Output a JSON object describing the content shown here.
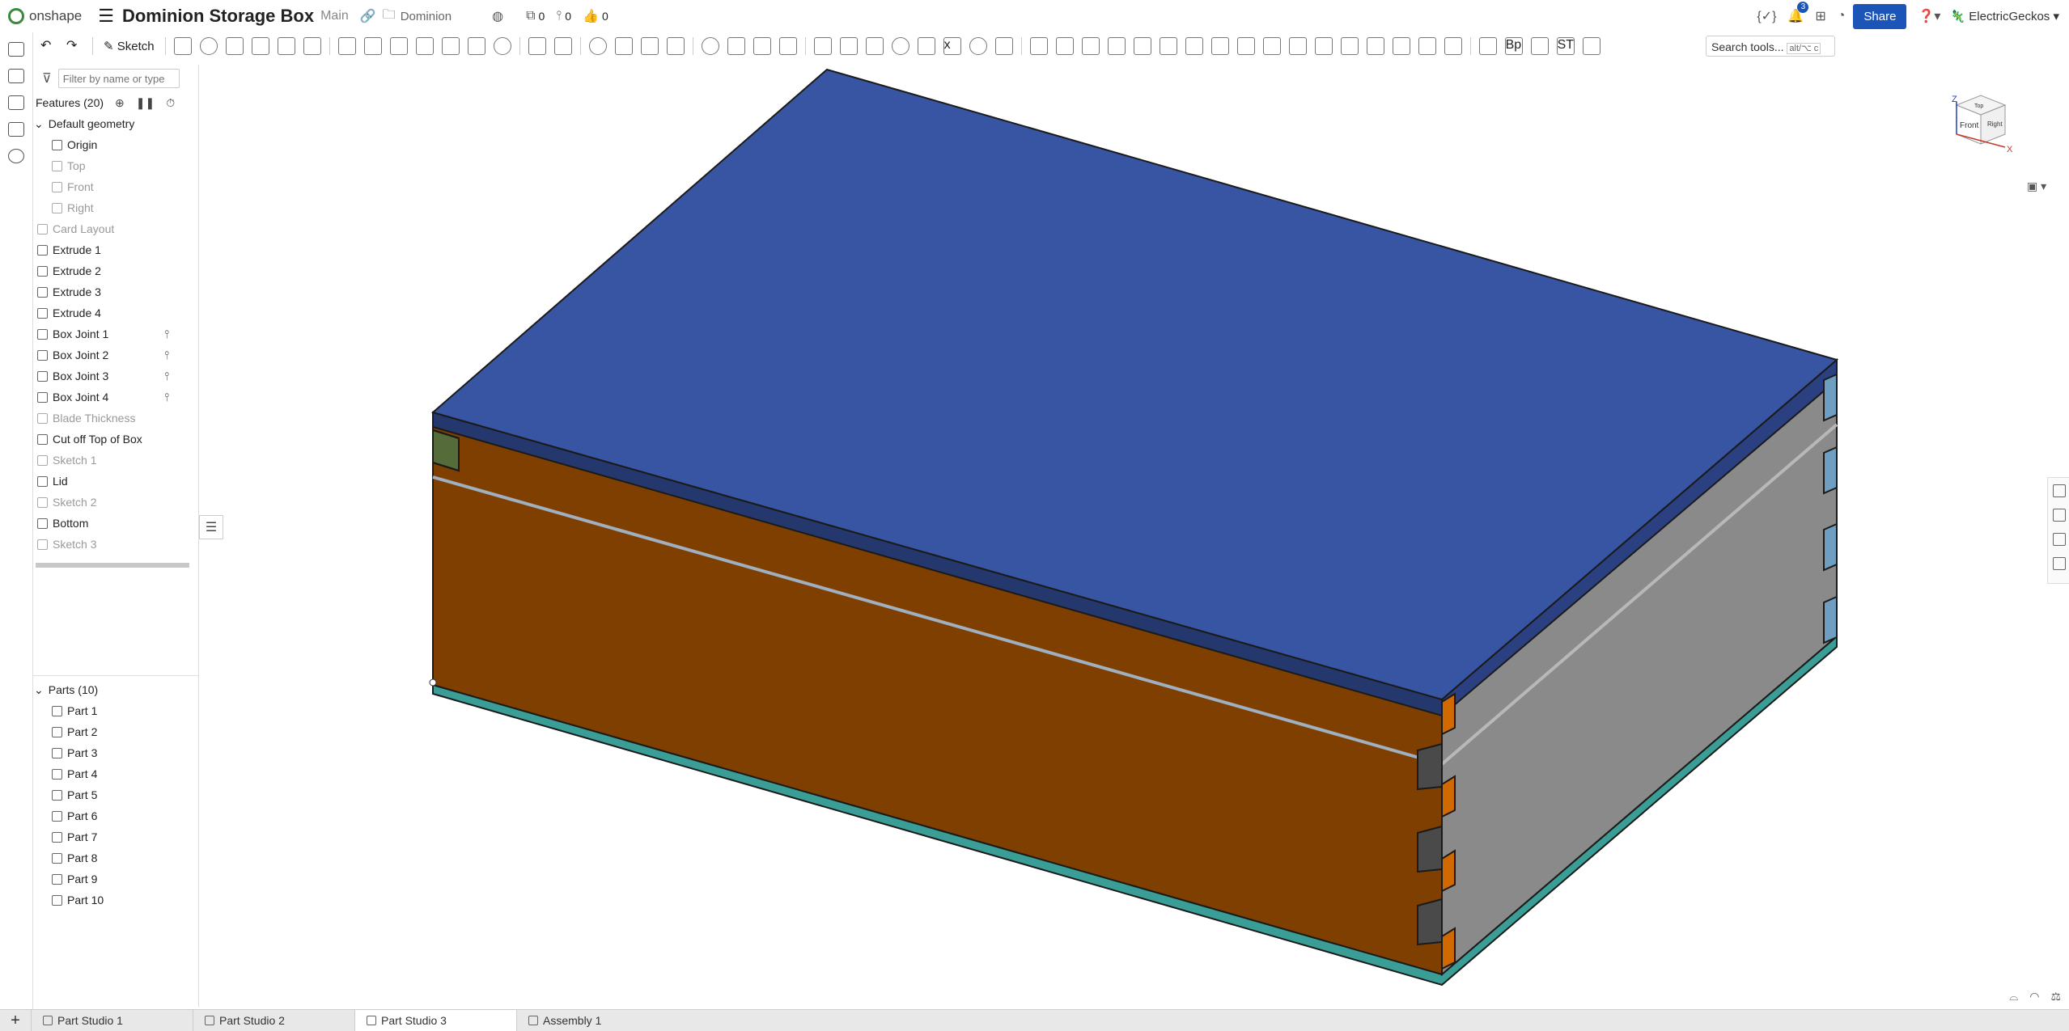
{
  "header": {
    "logo_text": "onshape",
    "doc_title": "Dominion Storage Box",
    "branch": "Main",
    "folder": "Dominion",
    "versions_count": "0",
    "branches_count": "0",
    "likes_count": "0",
    "notifications_count": "3",
    "share_label": "Share",
    "user_name": "ElectricGeckos"
  },
  "toolbar": {
    "sketch_label": "Sketch",
    "search_placeholder": "Search tools...",
    "search_shortcut": "alt/⌥ c"
  },
  "features": {
    "filter_placeholder": "Filter by name or type",
    "header": "Features (20)",
    "default_geometry": "Default geometry",
    "items": [
      {
        "label": "Origin",
        "indent": 2,
        "dim": false
      },
      {
        "label": "Top",
        "indent": 2,
        "dim": true
      },
      {
        "label": "Front",
        "indent": 2,
        "dim": true
      },
      {
        "label": "Right",
        "indent": 2,
        "dim": true
      },
      {
        "label": "Card Layout",
        "indent": 1,
        "dim": true
      },
      {
        "label": "Extrude 1",
        "indent": 1,
        "dim": false
      },
      {
        "label": "Extrude 2",
        "indent": 1,
        "dim": false
      },
      {
        "label": "Extrude 3",
        "indent": 1,
        "dim": false
      },
      {
        "label": "Extrude 4",
        "indent": 1,
        "dim": false
      },
      {
        "label": "Box Joint 1",
        "indent": 1,
        "dim": false,
        "pin": true
      },
      {
        "label": "Box Joint 2",
        "indent": 1,
        "dim": false,
        "pin": true
      },
      {
        "label": "Box Joint 3",
        "indent": 1,
        "dim": false,
        "pin": true
      },
      {
        "label": "Box Joint 4",
        "indent": 1,
        "dim": false,
        "pin": true
      },
      {
        "label": "Blade Thickness",
        "indent": 1,
        "dim": true
      },
      {
        "label": "Cut off Top of Box",
        "indent": 1,
        "dim": false
      },
      {
        "label": "Sketch 1",
        "indent": 1,
        "dim": true
      },
      {
        "label": "Lid",
        "indent": 1,
        "dim": false
      },
      {
        "label": "Sketch 2",
        "indent": 1,
        "dim": true
      },
      {
        "label": "Bottom",
        "indent": 1,
        "dim": false
      },
      {
        "label": "Sketch 3",
        "indent": 1,
        "dim": true
      }
    ]
  },
  "parts": {
    "header": "Parts (10)",
    "items": [
      "Part 1",
      "Part 2",
      "Part 3",
      "Part 4",
      "Part 5",
      "Part 6",
      "Part 7",
      "Part 8",
      "Part 9",
      "Part 10"
    ]
  },
  "viewcube": {
    "z_label": "Z",
    "x_label": "X",
    "front_label": "Front",
    "top_label": "Top",
    "right_label": "Right"
  },
  "tabs": [
    {
      "label": "Part Studio 1",
      "active": false
    },
    {
      "label": "Part Studio 2",
      "active": false
    },
    {
      "label": "Part Studio 3",
      "active": true
    },
    {
      "label": "Assembly 1",
      "active": false
    }
  ],
  "colors": {
    "lid_top": "#3755a3",
    "front_face": "#7e3f00",
    "side_face": "#8a8a8a",
    "bottom_plate": "#3a9d96",
    "joint_green": "#556b3a",
    "joint_blue": "#6f9ec0",
    "accent": "#1c55b8"
  }
}
